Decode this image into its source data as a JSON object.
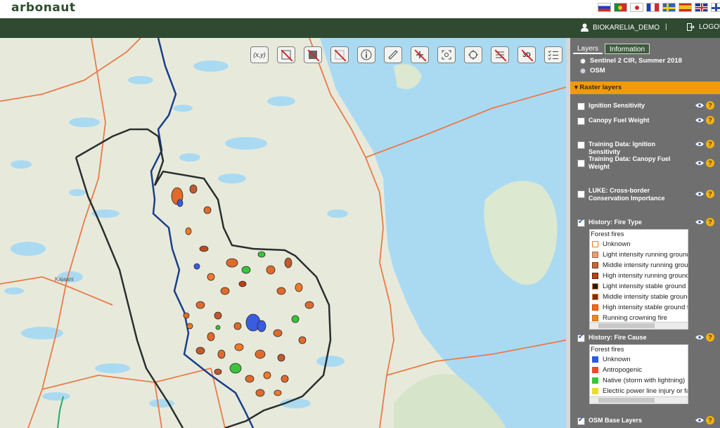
{
  "app": {
    "logo": "arbonaut"
  },
  "header": {
    "flags": [
      "russia-flag",
      "portugal-flag",
      "japan-flag",
      "france-flag",
      "sweden-flag",
      "spain-flag",
      "uk-flag",
      "finland-flag"
    ],
    "username": "BIOKARELIA_DEMO",
    "separator": "|",
    "logout_label": "LOGOUT"
  },
  "map": {
    "tools": [
      {
        "name": "coordinates-tool",
        "label": "(x,y)"
      },
      {
        "name": "measure-disabled-tool",
        "label": ""
      },
      {
        "name": "layer-disabled-tool",
        "label": ""
      },
      {
        "name": "draw-disabled-tool",
        "label": ""
      },
      {
        "name": "info-tool",
        "label": "i"
      },
      {
        "name": "ruler-tool",
        "label": ""
      },
      {
        "name": "add-disabled-tool",
        "label": ""
      },
      {
        "name": "zoom-extent-tool",
        "label": ""
      },
      {
        "name": "locate-tool",
        "label": ""
      },
      {
        "name": "table-disabled-tool",
        "label": ""
      },
      {
        "name": "3d-disabled-tool",
        "label": "3D"
      },
      {
        "name": "legend-tool",
        "label": ""
      }
    ],
    "place_labels": [
      {
        "text": "Kajaani"
      }
    ]
  },
  "panel": {
    "tabs": {
      "layers": "Layers",
      "information": "Information"
    },
    "base_layers": [
      "Sentinel 2 CIR, Summer 2018",
      "OSM"
    ],
    "raster_header": "Raster layers",
    "layers": {
      "ignition": "Ignition Sensitivity",
      "canopy": "Canopy Fuel Weight",
      "training_ignition": "Training Data: Ignition Sensitivity",
      "training_canopy": "Training Data: Canopy Fuel Weight",
      "luke": "LUKE: Cross-border Conservation Importance",
      "fire_type": "History: Fire Type",
      "fire_cause": "History: Fire Cause",
      "osm_base": "OSM Base Layers"
    },
    "fire_type_legend": {
      "title": "Forest fires",
      "items": [
        {
          "label": "Unknown",
          "color": "#ffffff",
          "border": "#f07a20"
        },
        {
          "label": "Light intensity running ground fire",
          "color": "#e0a07a",
          "border": "#b46a3c"
        },
        {
          "label": "Middle intensity running ground fire",
          "color": "#c06a3a",
          "border": "#7a3d1c"
        },
        {
          "label": "High intensity running ground fire",
          "color": "#b9421a",
          "border": "#6a220a"
        },
        {
          "label": "Light intensity stable ground fire",
          "color": "#1c1c1c",
          "border": "#f07a20"
        },
        {
          "label": "Middle intensity stable ground fire",
          "color": "#7a2d10",
          "border": "#f07a20"
        },
        {
          "label": "High intensity stable ground fire",
          "color": "#f26a1a",
          "border": "#d44a0a"
        },
        {
          "label": "Running crowning fire",
          "color": "#f2861a",
          "border": "#d46a0a"
        }
      ]
    },
    "fire_cause_legend": {
      "title": "Forest fires",
      "items": [
        {
          "label": "Unknown",
          "color": "#2a5ce0"
        },
        {
          "label": "Antropogenic",
          "color": "#f04a2a"
        },
        {
          "label": "Native (storm with lightning)",
          "color": "#3ac43a"
        },
        {
          "label": "Electric power line injury or fault",
          "color": "#eadc2a"
        }
      ]
    },
    "help_glyph": "?"
  }
}
